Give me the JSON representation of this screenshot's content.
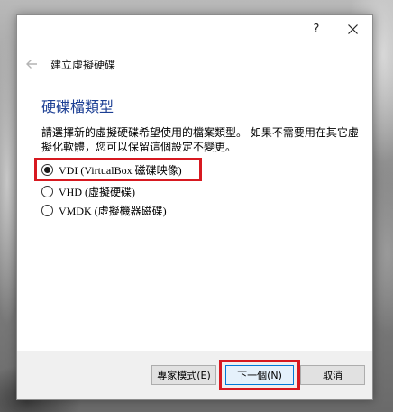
{
  "titlebar": {
    "help_label": "?",
    "close_icon": "close-icon"
  },
  "header": {
    "back_icon": "back-arrow-icon",
    "title": "建立虛擬硬碟"
  },
  "section": {
    "title": "硬碟檔類型",
    "description": "請選擇新的虛擬硬碟希望使用的檔案類型。 如果不需要用在其它虛擬化軟體，您可以保留這個設定不變更。"
  },
  "options": [
    {
      "label": "VDI (VirtualBox 磁碟映像)",
      "selected": true
    },
    {
      "label": "VHD (虛擬硬碟)",
      "selected": false
    },
    {
      "label": "VMDK (虛擬機器磁碟)",
      "selected": false
    }
  ],
  "buttons": {
    "expert": "專家模式(E)",
    "next": "下一個(N)",
    "cancel": "取消"
  },
  "colors": {
    "section_title": "#1c3f94",
    "highlight": "#d71920",
    "default_button_border": "#0078d7"
  }
}
